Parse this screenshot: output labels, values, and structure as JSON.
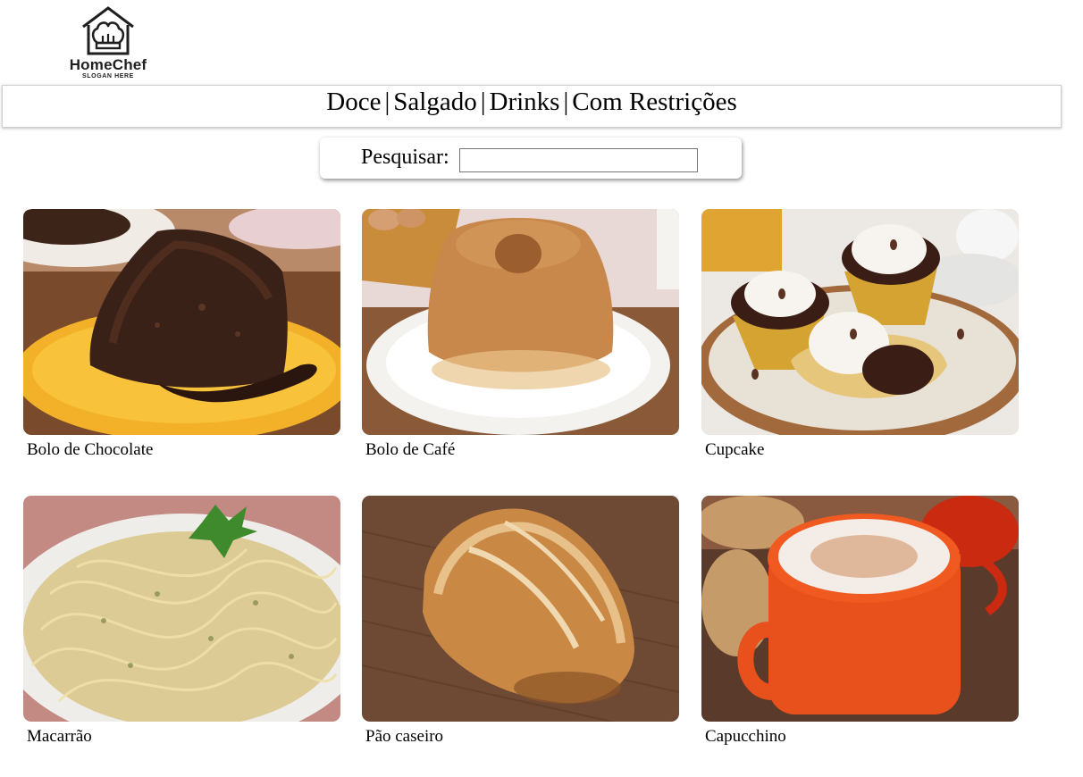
{
  "logo": {
    "name": "HomeChef",
    "slogan": "SLOGAN HERE",
    "icon": "chef-hat-house-icon"
  },
  "nav": {
    "items": [
      {
        "label": "Doce"
      },
      {
        "label": "Salgado"
      },
      {
        "label": "Drinks"
      },
      {
        "label": "Com Restrições"
      }
    ],
    "separator": "|"
  },
  "search": {
    "label": "Pesquisar:",
    "value": ""
  },
  "recipes": [
    {
      "title": "Bolo de Chocolate",
      "image": "chocolate-cake-photo"
    },
    {
      "title": "Bolo de Café",
      "image": "coffee-cake-photo"
    },
    {
      "title": "Cupcake",
      "image": "cupcake-photo"
    },
    {
      "title": "Macarrão",
      "image": "spaghetti-photo"
    },
    {
      "title": "Pão caseiro",
      "image": "homemade-bread-photo"
    },
    {
      "title": "Capucchino",
      "image": "cappuccino-photo"
    }
  ]
}
